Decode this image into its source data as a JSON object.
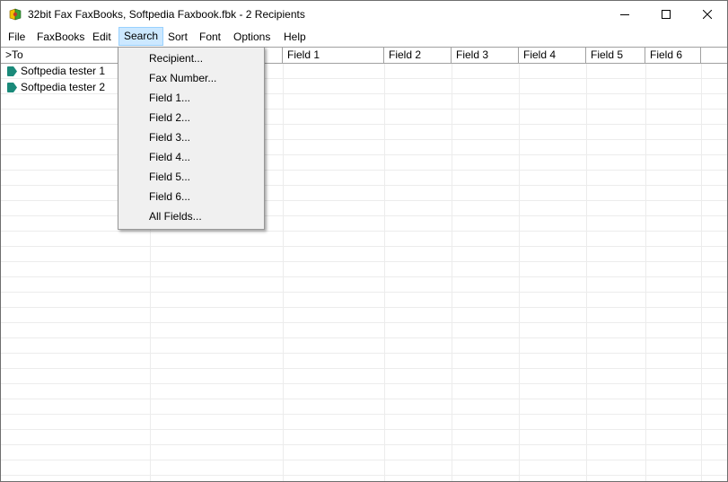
{
  "window": {
    "title": "32bit Fax FaxBooks, Softpedia Faxbook.fbk - 2 Recipients"
  },
  "menubar": {
    "items": [
      "File",
      "FaxBooks",
      "Edit",
      "Search",
      "Sort",
      "Font",
      "Options",
      "Help"
    ]
  },
  "search_menu": {
    "items": [
      "Recipient...",
      "Fax Number...",
      "Field 1...",
      "Field 2...",
      "Field 3...",
      "Field 4...",
      "Field 5...",
      "Field 6...",
      "All Fields..."
    ]
  },
  "grid": {
    "columns": [
      ">To",
      "Field 1",
      "Field 2",
      "Field 3",
      "Field 4",
      "Field 5",
      "Field 6"
    ],
    "rows": [
      {
        "to": "Softpedia tester 1"
      },
      {
        "to": "Softpedia tester 2"
      }
    ]
  },
  "colors": {
    "tag": "#1a8a7a",
    "menu_active_bg": "#cce8ff"
  }
}
